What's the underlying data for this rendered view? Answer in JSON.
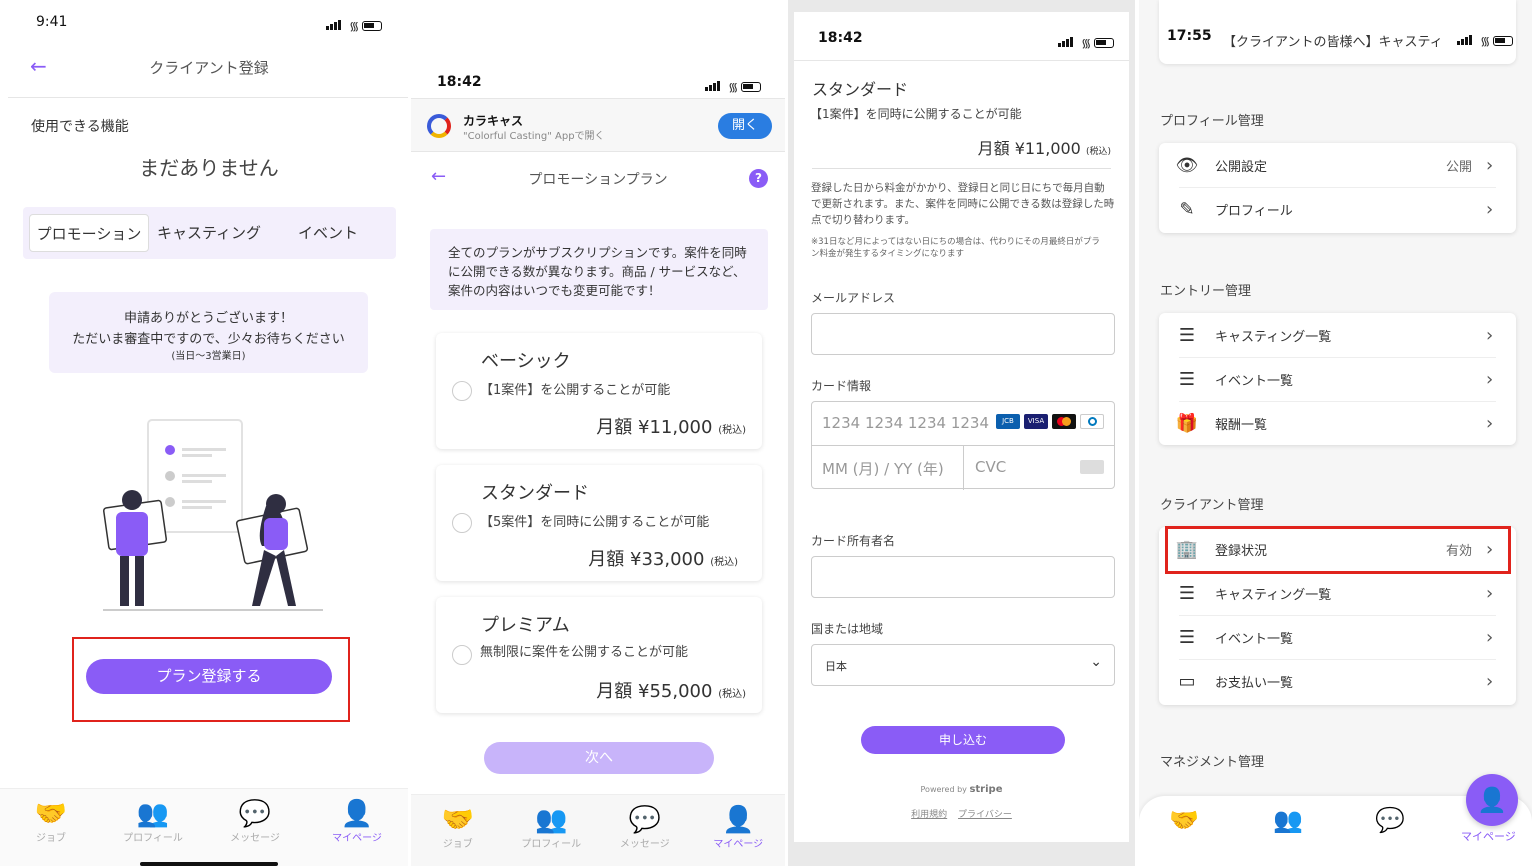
{
  "s1": {
    "time": "9:41",
    "title": "クライアント登録",
    "features_label": "使用できる機能",
    "features_value": "まだありません",
    "tabs": [
      "プロモーション",
      "キャスティング",
      "イベント"
    ],
    "notice_l1": "申請ありがとうございます！",
    "notice_l2": "ただいま審査中ですので、少々お待ちください",
    "notice_l3": "(当日〜3営業日)",
    "cta": "プラン登録する",
    "tabbar": [
      "ジョブ",
      "プロフィール",
      "メッセージ",
      "マイページ"
    ]
  },
  "s2": {
    "time": "18:42",
    "app_name": "カラキャス",
    "app_sub": "\"Colorful Casting\" Appで開く",
    "open_btn": "開く",
    "title": "プロモーションプラン",
    "help": "?",
    "intro": "全てのプランがサブスクリプションです。案件を同時に公開できる数が異なります。商品 / サービスなど、案件の内容はいつでも変更可能です！",
    "plans": [
      {
        "name": "ベーシック",
        "desc": "【1案件】を公開することが可能",
        "price": "月額 ¥11,000",
        "tax": "(税込)"
      },
      {
        "name": "スタンダード",
        "desc": "【5案件】を同時に公開することが可能",
        "price": "月額 ¥33,000",
        "tax": "(税込)"
      },
      {
        "name": "プレミアム",
        "desc": "無制限に案件を公開することが可能",
        "price": "月額 ¥55,000",
        "tax": "(税込)"
      }
    ],
    "next": "次へ",
    "tabbar": [
      "ジョブ",
      "プロフィール",
      "メッセージ",
      "マイページ"
    ]
  },
  "s3": {
    "time": "18:42",
    "plan_name": "スタンダード",
    "plan_desc": "【1案件】を同時に公開することが可能",
    "price": "月額 ¥11,000",
    "tax": "(税込)",
    "terms": "登録した日から料金がかかり、登録日と同じ日にちで毎月自動で更新されます。また、案件を同時に公開できる数は登録した時点で切り替わります。",
    "note": "※31日など月によってはない日にちの場合は、代わりにその月最終日がプラン料金が発生するタイミングになります",
    "email_label": "メールアドレス",
    "card_label": "カード情報",
    "card_placeholder": "1234 1234 1234 1234",
    "exp_placeholder": "MM (月) / YY (年)",
    "cvc_placeholder": "CVC",
    "holder_label": "カード所有者名",
    "country_label": "国または地域",
    "country_value": "日本",
    "submit": "申し込む",
    "powered": "Powered by",
    "stripe": "stripe",
    "terms_link": "利用規約",
    "privacy_link": "プライバシー"
  },
  "s4": {
    "time": "17:55",
    "header_text": "【クライアントの皆様へ】キャスティ",
    "sections": [
      {
        "title": "プロフィール管理"
      },
      {
        "title": "エントリー管理"
      },
      {
        "title": "クライアント管理"
      },
      {
        "title": "マネジメント管理"
      }
    ],
    "profile_rows": [
      {
        "icon": "eye-icon",
        "label": "公開設定",
        "value": "公開"
      },
      {
        "icon": "pencil-icon",
        "label": "プロフィール",
        "value": ""
      }
    ],
    "entry_rows": [
      {
        "icon": "list-icon",
        "label": "キャスティング一覧"
      },
      {
        "icon": "list-icon",
        "label": "イベント一覧"
      },
      {
        "icon": "gift-icon",
        "label": "報酬一覧"
      }
    ],
    "client_rows": [
      {
        "icon": "building-icon",
        "label": "登録状況",
        "value": "有効"
      },
      {
        "icon": "list-icon",
        "label": "キャスティング一覧",
        "value": ""
      },
      {
        "icon": "list-icon",
        "label": "イベント一覧",
        "value": ""
      },
      {
        "icon": "card-icon",
        "label": "お支払い一覧",
        "value": ""
      }
    ],
    "mypage": "マイページ"
  },
  "colors": {
    "accent": "#8a5cf6",
    "highlight": "#e0231c",
    "lavender": "#f3effc"
  }
}
